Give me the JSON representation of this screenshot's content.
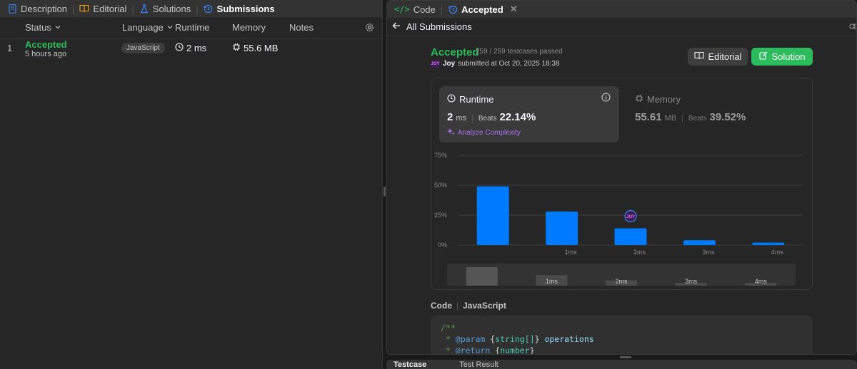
{
  "left": {
    "tabs": [
      {
        "label": "Description",
        "icon": "description-icon",
        "color": "#3b82f6"
      },
      {
        "label": "Editorial",
        "icon": "book-icon",
        "color": "#ffa116"
      },
      {
        "label": "Solutions",
        "icon": "flask-icon",
        "color": "#3b82f6"
      },
      {
        "label": "Submissions",
        "icon": "history-icon",
        "color": "#3b82f6"
      }
    ],
    "columns": {
      "status": "Status",
      "language": "Language",
      "runtime": "Runtime",
      "memory": "Memory",
      "notes": "Notes"
    },
    "rows": [
      {
        "index": "1",
        "status": "Accepted",
        "time_ago": "5 hours ago",
        "language": "JavaScript",
        "runtime": "2 ms",
        "memory": "55.6 MB"
      }
    ]
  },
  "right": {
    "tabs": [
      {
        "label": "Code",
        "icon": "code-icon"
      },
      {
        "label": "Accepted",
        "icon": "history-icon"
      }
    ],
    "back_label": "All Submissions",
    "result": {
      "status": "Accepted",
      "testcases": "259 / 259 testcases passed",
      "avatar_text": "JOY",
      "user": "Joy",
      "submitted": "submitted at Oct 20, 2025 18:38"
    },
    "buttons": {
      "editorial": "Editorial",
      "solution": "Solution"
    },
    "runtime": {
      "label": "Runtime",
      "value": "2",
      "unit": "ms",
      "beats_label": "Beats",
      "beats": "22.14%",
      "analyze": "Analyze Complexity"
    },
    "memory": {
      "label": "Memory",
      "value": "55.61",
      "unit": "MB",
      "beats_label": "Beats",
      "beats": "39.52%"
    },
    "code": {
      "label": "Code",
      "language": "JavaScript",
      "lines": [
        [
          {
            "t": "/**",
            "c": "c-com"
          }
        ],
        [
          {
            "t": " * ",
            "c": "c-com"
          },
          {
            "t": "@param",
            "c": "c-kw"
          },
          {
            "t": " {",
            "c": "c-p"
          },
          {
            "t": "string[]",
            "c": "c-ty"
          },
          {
            "t": "} ",
            "c": "c-p"
          },
          {
            "t": "operations",
            "c": "c-id"
          }
        ],
        [
          {
            "t": " * ",
            "c": "c-com"
          },
          {
            "t": "@return",
            "c": "c-kw"
          },
          {
            "t": " {",
            "c": "c-p"
          },
          {
            "t": "number",
            "c": "c-ty"
          },
          {
            "t": "}",
            "c": "c-p"
          }
        ]
      ]
    },
    "bottom_tabs": [
      "Testcase",
      "Test Result"
    ]
  },
  "chart_data": {
    "type": "bar",
    "title": "",
    "xlabel": "",
    "ylabel": "",
    "yticks": [
      "75%",
      "50%",
      "25%",
      "0%"
    ],
    "ylim": [
      0,
      75
    ],
    "categories": [
      "",
      "1ms",
      "2ms",
      "3ms",
      "4ms"
    ],
    "values": [
      49,
      28,
      14,
      4,
      2
    ],
    "highlight_index": 2,
    "highlight_marker": "JOY",
    "bar_color": "#007aff",
    "navigator_labels": [
      "",
      "1ms",
      "2ms",
      "3ms",
      "4ms"
    ]
  }
}
